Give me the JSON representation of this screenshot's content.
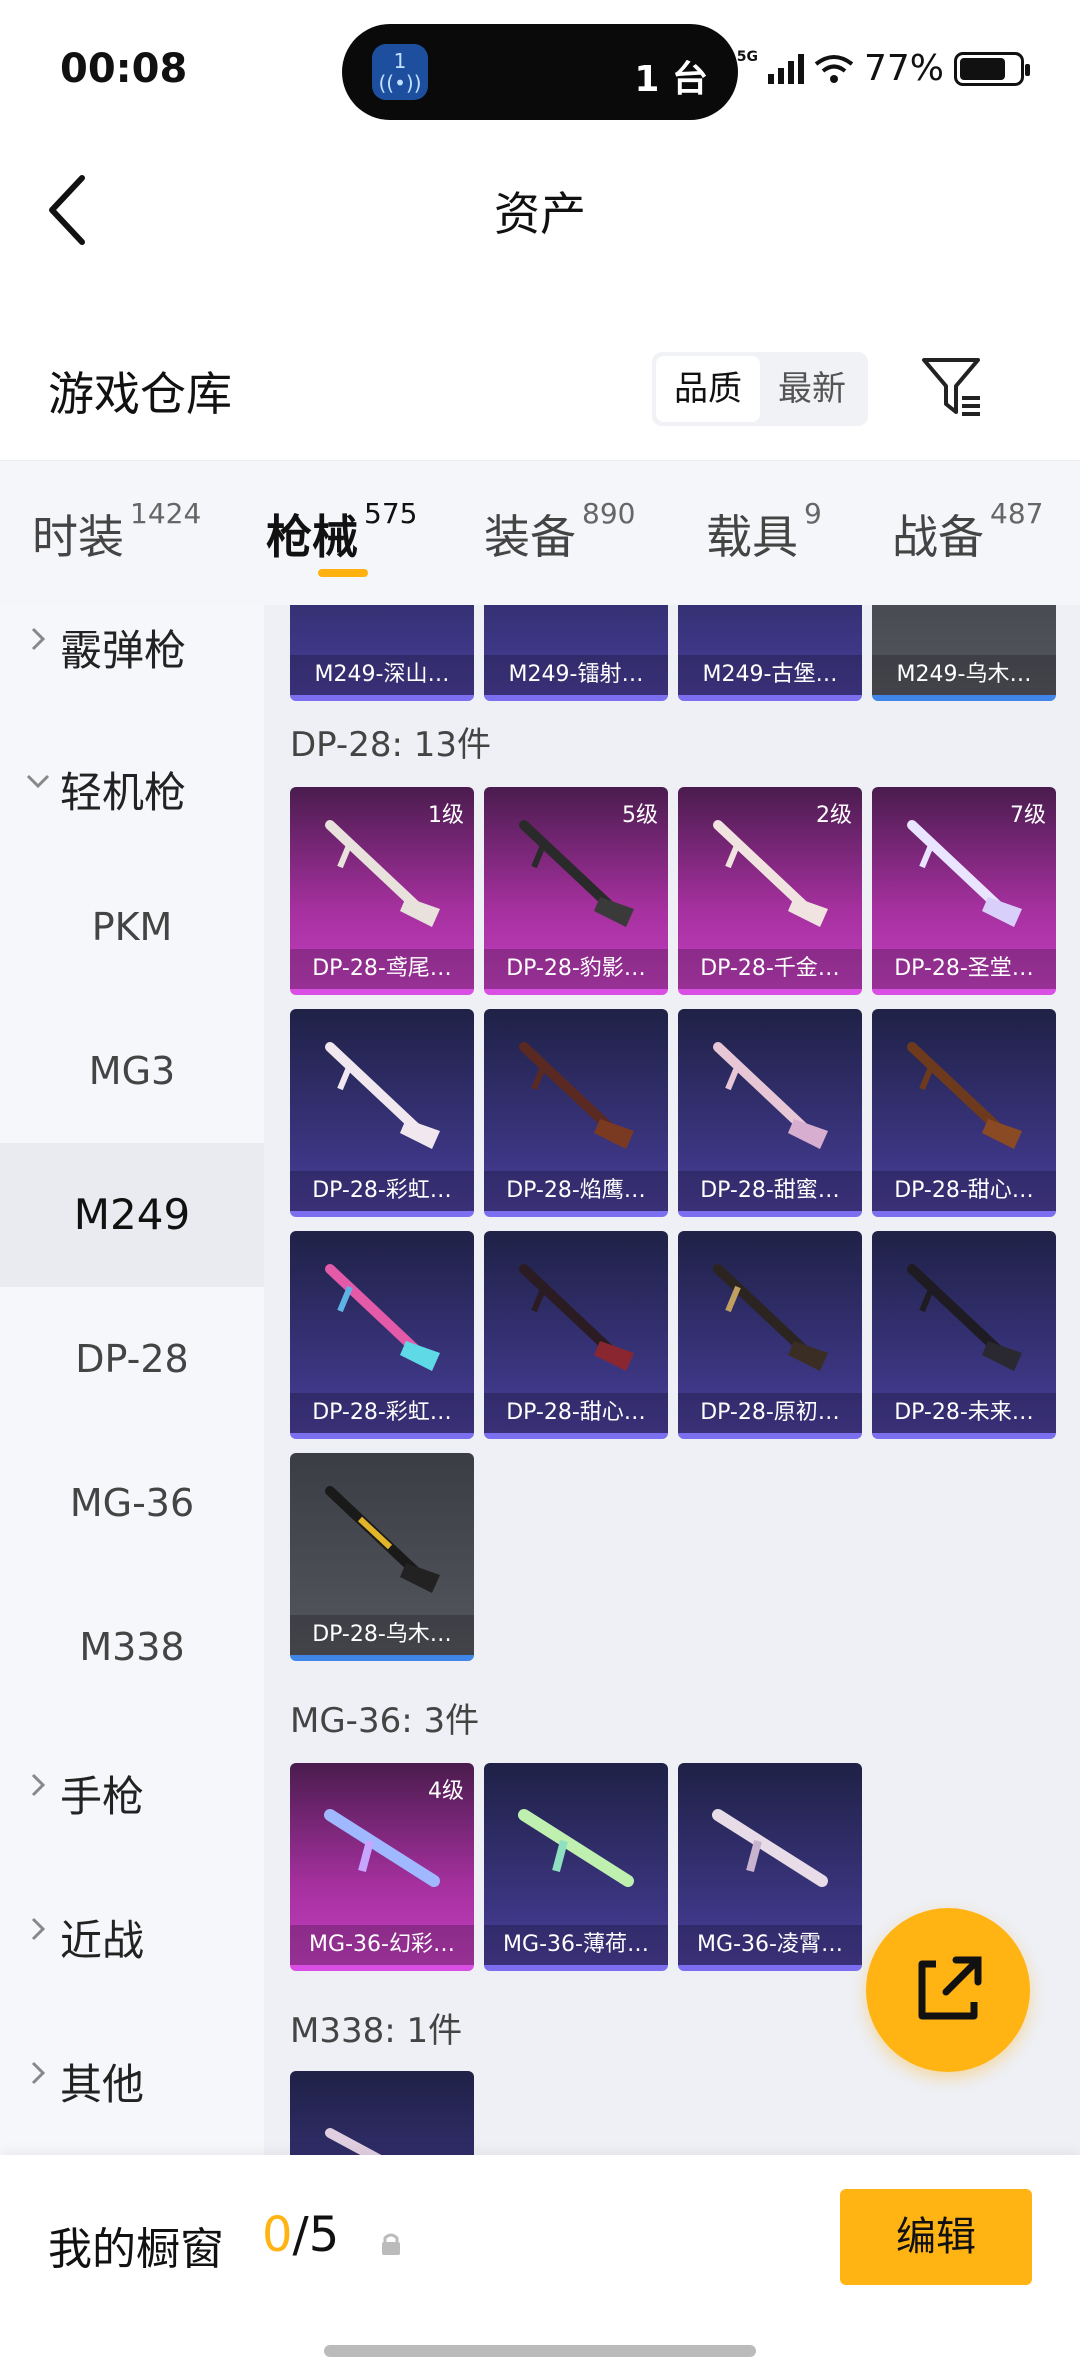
{
  "status": {
    "time": "00:08",
    "island_badge": "1",
    "island_text": "1 台",
    "network": "5G",
    "battery": "77%"
  },
  "header": {
    "title": "资产"
  },
  "warehouse": {
    "title": "游戏仓库",
    "sort_options": [
      "品质",
      "最新"
    ],
    "sort_active": 0
  },
  "tabs": [
    {
      "label": "时装",
      "count": "1424"
    },
    {
      "label": "枪械",
      "count": "575"
    },
    {
      "label": "装备",
      "count": "890"
    },
    {
      "label": "载具",
      "count": "9"
    },
    {
      "label": "战备",
      "count": "487"
    }
  ],
  "sidebar": {
    "shotgun": "霰弹枪",
    "lmg": "轻机枪",
    "subs": [
      "PKM",
      "MG3",
      "M249",
      "DP-28",
      "MG-36",
      "M338"
    ],
    "pistol": "手枪",
    "melee": "近战",
    "other": "其他"
  },
  "content": {
    "top_row": [
      "M249-深山…",
      "M249-镭射…",
      "M249-古堡…",
      "M249-乌木…"
    ],
    "dp28_title": "DP-28: 13件",
    "dp28": [
      {
        "name": "DP-28-鸢尾…",
        "level": "1级"
      },
      {
        "name": "DP-28-豹影…",
        "level": "5级"
      },
      {
        "name": "DP-28-千金…",
        "level": "2级"
      },
      {
        "name": "DP-28-圣堂…",
        "level": "7级"
      },
      {
        "name": "DP-28-彩虹…",
        "level": ""
      },
      {
        "name": "DP-28-焰鹰…",
        "level": ""
      },
      {
        "name": "DP-28-甜蜜…",
        "level": ""
      },
      {
        "name": "DP-28-甜心…",
        "level": ""
      },
      {
        "name": "DP-28-彩虹…",
        "level": ""
      },
      {
        "name": "DP-28-甜心…",
        "level": ""
      },
      {
        "name": "DP-28-原初…",
        "level": ""
      },
      {
        "name": "DP-28-未来…",
        "level": ""
      },
      {
        "name": "DP-28-乌木…",
        "level": ""
      }
    ],
    "mg36_title": "MG-36: 3件",
    "mg36": [
      {
        "name": "MG-36-幻彩…",
        "level": "4级"
      },
      {
        "name": "MG-36-薄荷…",
        "level": ""
      },
      {
        "name": "MG-36-凌霄…",
        "level": ""
      }
    ],
    "m338_title": "M338: 1件"
  },
  "bottom": {
    "showcase_label": "我的橱窗",
    "showcase_current": "0",
    "showcase_total": "/5",
    "edit_label": "编辑"
  },
  "colors": {
    "accent": "#ffb414"
  }
}
